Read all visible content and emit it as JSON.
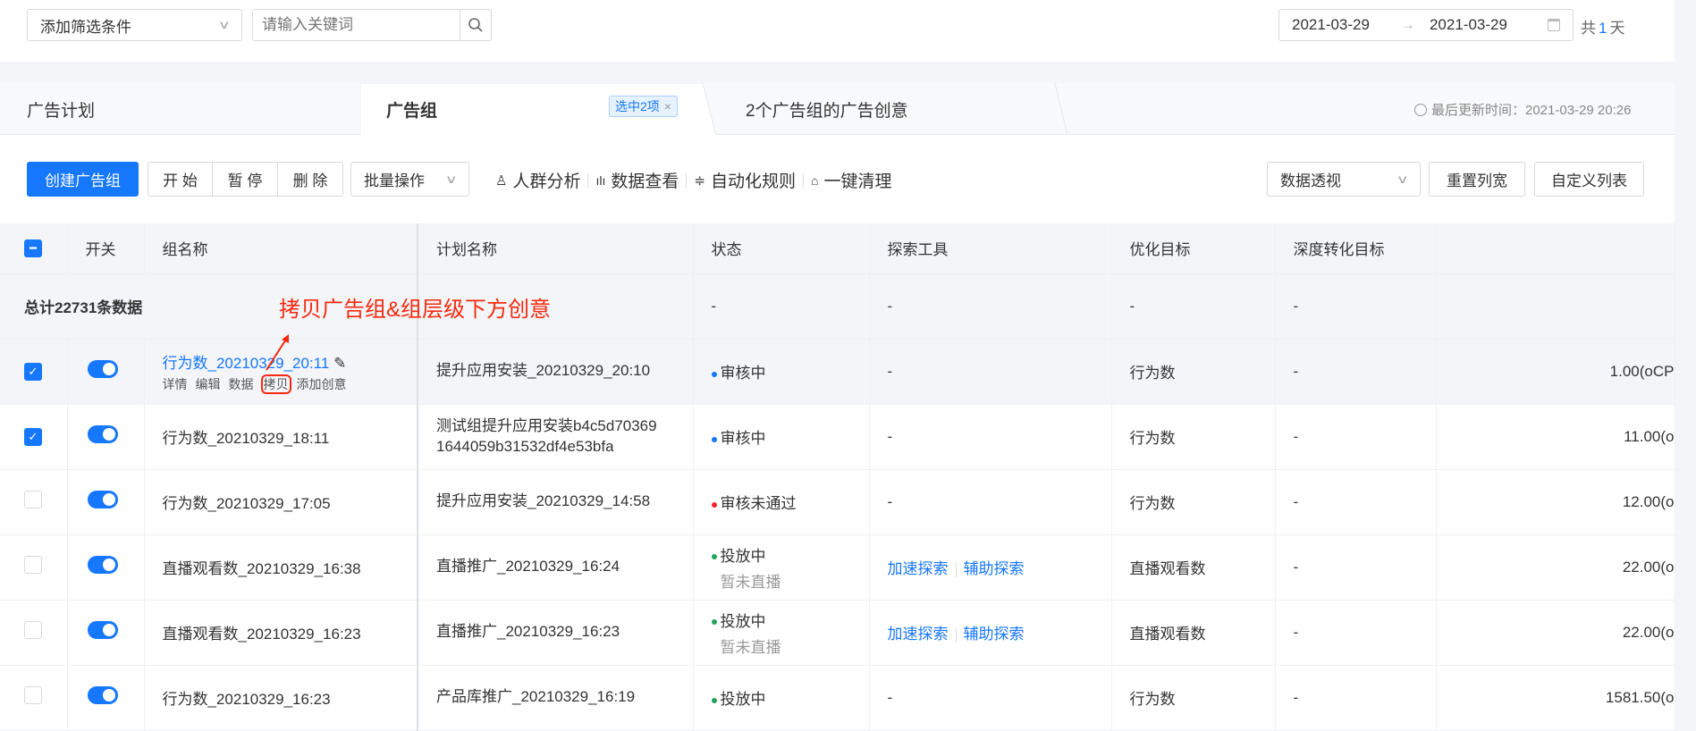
{
  "filter": {
    "add_label": "添加筛选条件",
    "search_placeholder": "请输入关键词",
    "date_start": "2021-03-29",
    "date_arrow": "→",
    "date_end": "2021-03-29",
    "days_prefix": "共",
    "days_count": "1",
    "days_suffix": "天"
  },
  "tabs": [
    {
      "label": "广告计划"
    },
    {
      "label": "广告组",
      "badge": "选中2项",
      "badge_close": "×"
    },
    {
      "label": "2个广告组的广告创意"
    }
  ],
  "last_update": "最后更新时间：2021-03-29 20:26",
  "toolbar": {
    "create": "创建广告组",
    "start": "开 始",
    "pause": "暂 停",
    "delete": "删 除",
    "batch": "批量操作",
    "audience": "人群分析",
    "data_view": "数据查看",
    "auto_rules": "自动化规则",
    "clean": "一键清理",
    "pivot": "数据透视",
    "reset_width": "重置列宽",
    "custom_list": "自定义列表"
  },
  "columns": [
    "开关",
    "组名称",
    "计划名称",
    "状态",
    "探索工具",
    "优化目标",
    "深度转化目标",
    ""
  ],
  "summary": {
    "label": "总计22731条数据",
    "status": "-",
    "tool": "-",
    "goal": "-",
    "deep": "-"
  },
  "annotation": "拷贝广告组&组层级下方创意",
  "row_actions": [
    "详情",
    "编辑",
    "数据",
    "拷贝",
    "添加创意"
  ],
  "rows": [
    {
      "checked": true,
      "name": "行为数_20210329_20:11",
      "plan": "提升应用安装_20210329_20:10",
      "plan2": "",
      "status": "审核中",
      "status_color": "#1677ff",
      "status_sub": "",
      "tools": [],
      "goal": "行为数",
      "deep": "-",
      "bid": "1.00(oCP"
    },
    {
      "checked": true,
      "name": "行为数_20210329_18:11",
      "plan": "测试组提升应用安装b4c5d70369",
      "plan2": "1644059b31532df4e53bfa",
      "status": "审核中",
      "status_color": "#1677ff",
      "status_sub": "",
      "tools": [],
      "goal": "行为数",
      "deep": "-",
      "bid": "11.00(o"
    },
    {
      "checked": false,
      "name": "行为数_20210329_17:05",
      "plan": "提升应用安装_20210329_14:58",
      "plan2": "",
      "status": "审核未通过",
      "status_color": "#f5222d",
      "status_sub": "",
      "tools": [],
      "goal": "行为数",
      "deep": "-",
      "bid": "12.00(o"
    },
    {
      "checked": false,
      "name": "直播观看数_20210329_16:38",
      "plan": "直播推广_20210329_16:24",
      "plan2": "",
      "status": "投放中",
      "status_color": "#21a35a",
      "status_sub": "暂未直播",
      "tools": [
        "加速探索",
        "辅助探索"
      ],
      "goal": "直播观看数",
      "deep": "-",
      "bid": "22.00(o"
    },
    {
      "checked": false,
      "name": "直播观看数_20210329_16:23",
      "plan": "直播推广_20210329_16:23",
      "plan2": "",
      "status": "投放中",
      "status_color": "#21a35a",
      "status_sub": "暂未直播",
      "tools": [
        "加速探索",
        "辅助探索"
      ],
      "goal": "直播观看数",
      "deep": "-",
      "bid": "22.00(o"
    },
    {
      "checked": false,
      "name": "行为数_20210329_16:23",
      "plan": "产品库推广_20210329_16:19",
      "plan2": "",
      "status": "投放中",
      "status_color": "#21a35a",
      "status_sub": "",
      "tools": [],
      "goal": "行为数",
      "deep": "-",
      "bid": "1581.50(o"
    }
  ]
}
